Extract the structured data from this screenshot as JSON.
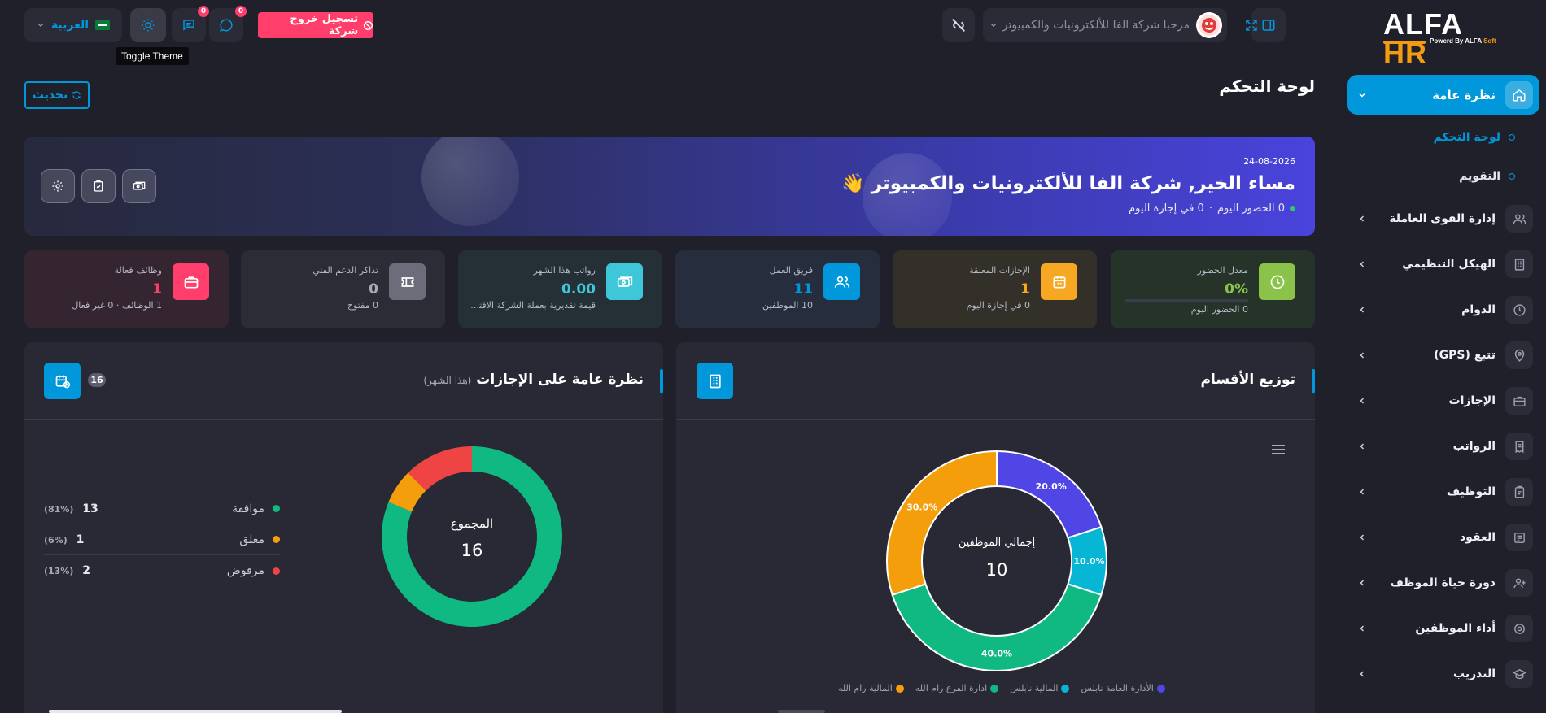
{
  "brand": {
    "logo_main": "ALFA",
    "logo_accent": "HR",
    "logo_sub_prefix": "Powerd By ALFA",
    "logo_sub_accent": "Soft",
    "logo_sub_suffix": ""
  },
  "topbar": {
    "company_greeting": "مرحبا شركة الفا للألكترونيات والكمبيوتر",
    "logout_label": "تسجيل خروج شركة",
    "language_label": "العربية",
    "messages_badge": "0",
    "notifications_badge": "0",
    "tooltip": "Toggle Theme"
  },
  "sidebar": {
    "active_section": "نظرة عامة",
    "sub_items": [
      {
        "label": "لوحة التحكم",
        "active": true
      },
      {
        "label": "التقويم",
        "active": false
      }
    ],
    "items": [
      {
        "label": "إدارة القوى العاملة",
        "icon": "users-icon"
      },
      {
        "label": "الهيكل التنظيمي",
        "icon": "building-icon"
      },
      {
        "label": "الدوام",
        "icon": "clock-icon"
      },
      {
        "label": "تتبع (GPS)",
        "icon": "location-icon"
      },
      {
        "label": "الإجازات",
        "icon": "briefcase-icon"
      },
      {
        "label": "الرواتب",
        "icon": "receipt-icon"
      },
      {
        "label": "التوظيف",
        "icon": "clipboard-icon"
      },
      {
        "label": "العقود",
        "icon": "contract-icon"
      },
      {
        "label": "دورة حياة الموظف",
        "icon": "user-plus-icon"
      },
      {
        "label": "أداء الموظفين",
        "icon": "target-icon"
      },
      {
        "label": "التدريب",
        "icon": "graduation-icon"
      }
    ]
  },
  "page": {
    "title": "لوحة التحكم",
    "refresh_label": "تحديث"
  },
  "banner": {
    "date": "24-08-2026",
    "greeting": "مساء الخير, شركة الفا للألكترونيات والكمبيوتر",
    "emoji": "👋",
    "present_today": "0 الحضور اليوم",
    "separator": "·",
    "on_leave_today": "0 في إجازة اليوم"
  },
  "stats": [
    {
      "title": "معدل الحضور",
      "value": "0%",
      "sub": "0 الحضور اليوم",
      "color": "#8bc34a",
      "icon": "clock-icon",
      "progress": 0
    },
    {
      "title": "الإجازات المعلقة",
      "value": "1",
      "sub": "0 في إجازة اليوم",
      "color": "#f7a823",
      "icon": "calendar-icon"
    },
    {
      "title": "فريق العمل",
      "value": "11",
      "sub": "10 الموظفين",
      "color": "#0098da",
      "icon": "users-icon"
    },
    {
      "title": "رواتب هذا الشهر",
      "value": "0.00",
      "sub": "قيمة تقديرية بعملة الشركة الافترا...",
      "color": "#3ec7d8",
      "icon": "money-icon"
    },
    {
      "title": "تذاكر الدعم الفني",
      "value": "0",
      "sub": "0 مفتوح",
      "color": "#6b6d7a",
      "icon": "ticket-icon"
    },
    {
      "title": "وظائف فعالة",
      "value": "1",
      "sub": "1 الوظائف · 0 غير فعال",
      "color": "#ff3e6c",
      "icon": "briefcase-icon"
    }
  ],
  "leaves_panel": {
    "title": "نظرة عامة على الإجازات",
    "period": "(هذا الشهر)",
    "count_badge": "16",
    "center_label": "المجموع",
    "center_value": "16"
  },
  "departments_panel": {
    "title": "توزيع الأقسام",
    "center_label": "إجمالي الموظفين",
    "center_value": "10"
  },
  "chart_data": [
    {
      "type": "pie",
      "title": "نظرة عامة على الإجازات",
      "categories": [
        "موافقة",
        "معلق",
        "مرفوض"
      ],
      "values": [
        13,
        1,
        2
      ],
      "percent_labels": [
        "(81%)",
        "(6%)",
        "(13%)"
      ],
      "colors": [
        "#10b981",
        "#f59e0b",
        "#ef4444"
      ],
      "legend": "left"
    },
    {
      "type": "pie",
      "title": "توزيع الأقسام",
      "categories": [
        "الأدارة العامة نابلس",
        "المالية نابلس",
        "ادارة الفرع رام الله",
        "المالية رام الله"
      ],
      "values": [
        20.0,
        10.0,
        40.0,
        30.0
      ],
      "value_labels": [
        "20.0%",
        "10.0%",
        "40.0%",
        "30.0%"
      ],
      "colors": [
        "#4f46e5",
        "#06b6d4",
        "#10b981",
        "#f59e0b"
      ],
      "legend": "bottom"
    }
  ]
}
